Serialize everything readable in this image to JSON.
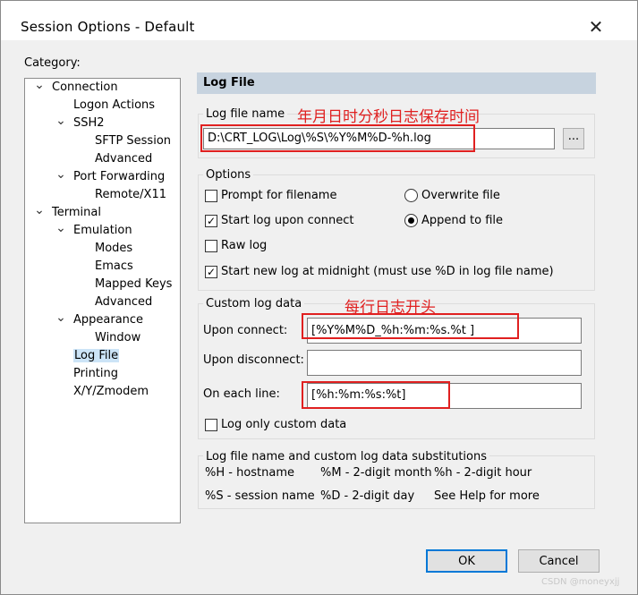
{
  "window": {
    "title": "Session Options - Default",
    "close_glyph": "✕"
  },
  "category_label": "Category:",
  "tree": [
    {
      "label": "Connection",
      "expanded": true
    },
    {
      "label": "Logon Actions"
    },
    {
      "label": "SSH2",
      "expanded": true
    },
    {
      "label": "SFTP Session"
    },
    {
      "label": "Advanced"
    },
    {
      "label": "Port Forwarding",
      "expanded": true
    },
    {
      "label": "Remote/X11"
    },
    {
      "label": "Terminal",
      "expanded": true
    },
    {
      "label": "Emulation",
      "expanded": true
    },
    {
      "label": "Modes"
    },
    {
      "label": "Emacs"
    },
    {
      "label": "Mapped Keys"
    },
    {
      "label": "Advanced"
    },
    {
      "label": "Appearance",
      "expanded": true
    },
    {
      "label": "Window"
    },
    {
      "label": "Log File",
      "selected": true
    },
    {
      "label": "Printing"
    },
    {
      "label": "X/Y/Zmodem"
    }
  ],
  "panel": {
    "header": "Log File",
    "log_file_name": {
      "label": "Log file name",
      "value": "D:\\CRT_LOG\\Log\\%S\\%Y%M%D-%h.log",
      "browse": "..."
    },
    "options": {
      "label": "Options",
      "prompt": {
        "label": "Prompt for filename",
        "checked": false
      },
      "start_on_connect": {
        "label": "Start log upon connect",
        "checked": true
      },
      "raw_log": {
        "label": "Raw log",
        "checked": false
      },
      "midnight": {
        "label": "Start new log at midnight (must use %D in log file name)",
        "checked": true
      },
      "overwrite": {
        "label": "Overwrite file",
        "selected": false
      },
      "append": {
        "label": "Append to file",
        "selected": true
      }
    },
    "custom": {
      "label": "Custom log data",
      "upon_connect_label": "Upon connect:",
      "upon_connect_value": "[%Y%M%D_%h:%m:%s.%t ]",
      "upon_disconnect_label": "Upon disconnect:",
      "upon_disconnect_value": "",
      "each_line_label": "On each line:",
      "each_line_value": "[%h:%m:%s:%t]",
      "only_custom": {
        "label": "Log only custom data",
        "checked": false
      }
    },
    "subs": {
      "label": "Log file name and custom log data substitutions",
      "r1c1": "%H - hostname",
      "r1c2": "%M - 2-digit month",
      "r1c3": "%h - 2-digit hour",
      "r2c1": "%S - session name",
      "r2c2": "%D - 2-digit day",
      "r2c3": "See Help for more"
    }
  },
  "annotations": {
    "a1": "年月日时分秒日志保存时间",
    "a2": "每行日志开头",
    "color": "#e02020"
  },
  "buttons": {
    "ok": "OK",
    "cancel": "Cancel"
  },
  "watermark": "CSDN @moneyxjj"
}
